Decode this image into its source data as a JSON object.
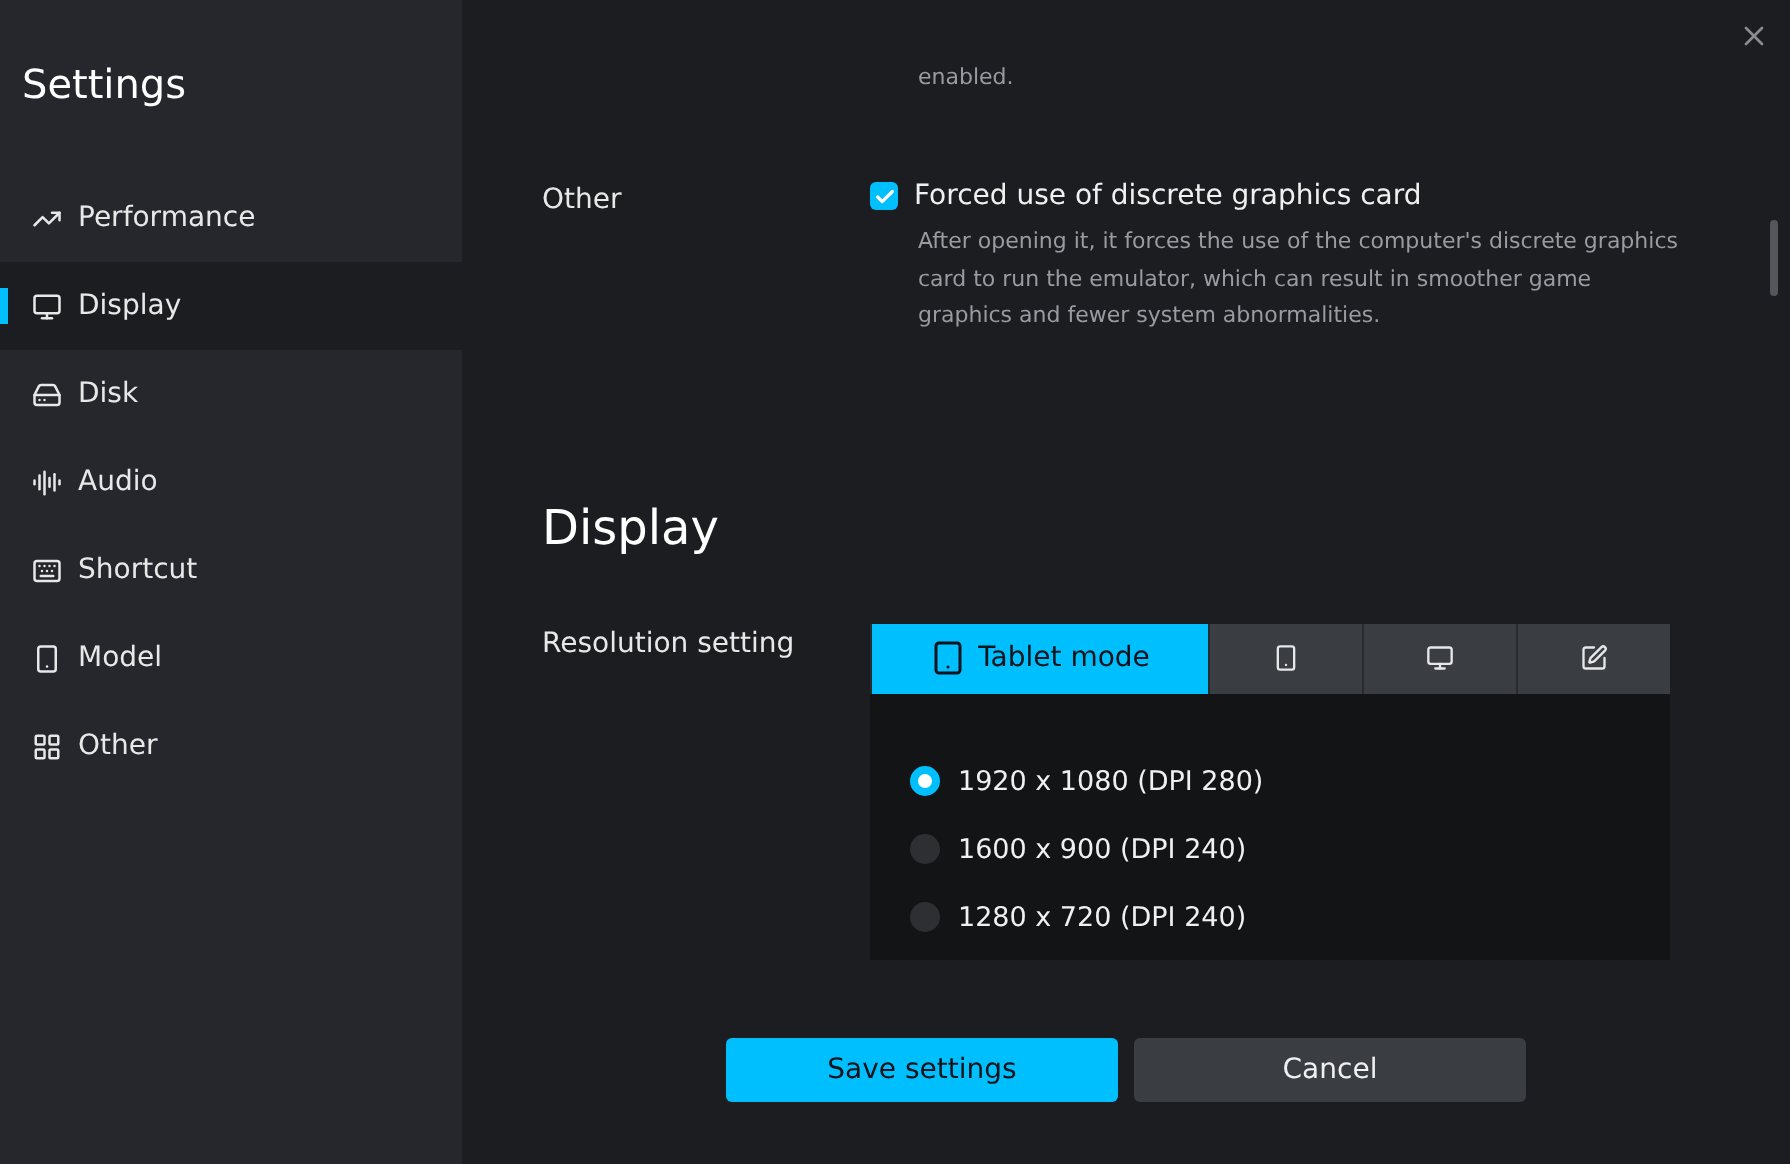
{
  "sidebar": {
    "title": "Settings",
    "items": [
      {
        "label": "Performance",
        "selected": false
      },
      {
        "label": "Display",
        "selected": true
      },
      {
        "label": "Disk",
        "selected": false
      },
      {
        "label": "Audio",
        "selected": false
      },
      {
        "label": "Shortcut",
        "selected": false
      },
      {
        "label": "Model",
        "selected": false
      },
      {
        "label": "Other",
        "selected": false
      }
    ]
  },
  "main": {
    "previous_note": "enabled.",
    "other": {
      "label": "Other",
      "option": {
        "label": "Forced use of discrete graphics card",
        "checked": true,
        "description": "After opening it, it forces the use of the computer's discrete graphics card to run the emulator, which can result in smoother game graphics and fewer system abnormalities."
      }
    },
    "display": {
      "heading": "Display",
      "resolution_label": "Resolution setting",
      "mode_tabs": [
        {
          "label": "Tablet mode",
          "selected": true
        },
        {
          "selected": false
        },
        {
          "selected": false
        },
        {
          "selected": false
        }
      ],
      "resolutions": [
        {
          "label": "1920 x 1080 (DPI 280)",
          "selected": true
        },
        {
          "label": "1600 x 900 (DPI 240)",
          "selected": false
        },
        {
          "label": "1280 x 720 (DPI 240)",
          "selected": false
        }
      ]
    }
  },
  "buttons": {
    "save": "Save settings",
    "cancel": "Cancel"
  }
}
